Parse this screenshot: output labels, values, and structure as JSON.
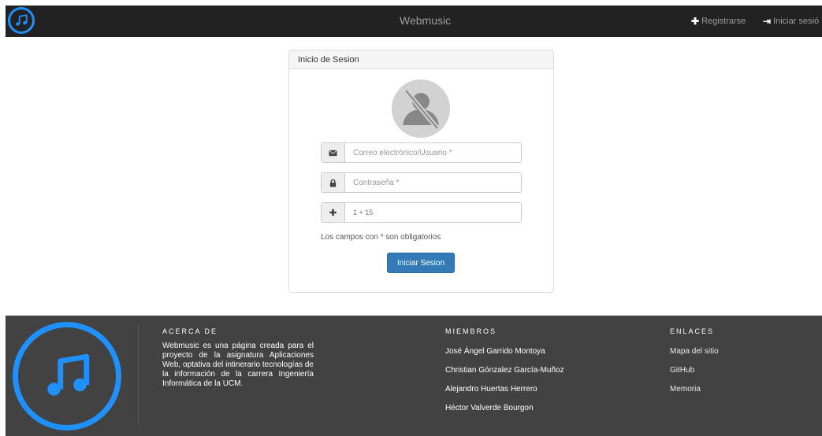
{
  "navbar": {
    "brand": "Webmusic",
    "register_label": "Registrarse",
    "login_label": "Iniciar sesió",
    "accent": "#1e90ff"
  },
  "login_panel": {
    "heading": "Inicio de Sesion",
    "email_placeholder": "Correo electrónico/Usuario *",
    "password_placeholder": "Contraseña *",
    "captcha_question": "1 + 15",
    "required_note": "Los campos con * son obligatorios",
    "submit_label": "Iniciar Sesion",
    "icons": [
      "envelope-icon",
      "lock-icon",
      "plus-icon",
      "user-avatar-icon"
    ]
  },
  "footer": {
    "about": {
      "heading": "ACERCA DE",
      "text": "Webmusic es una página creada para el proyecto de la asignatura Aplicaciones Web, optativa del intinerario tecnologías de la información de la carrera Ingeniería Informática de la UCM."
    },
    "members": {
      "heading": "MIEMBROS",
      "items": [
        "José Ángel Garrido Montoya",
        "Christian Gónzalez García-Muñoz",
        "Alejandro Huertas Herrero",
        "Héctor Valverde Bourgon"
      ]
    },
    "links": {
      "heading": "ENLACES",
      "items": [
        "Mapa del sitio",
        "GitHub",
        "Memoria"
      ]
    }
  }
}
